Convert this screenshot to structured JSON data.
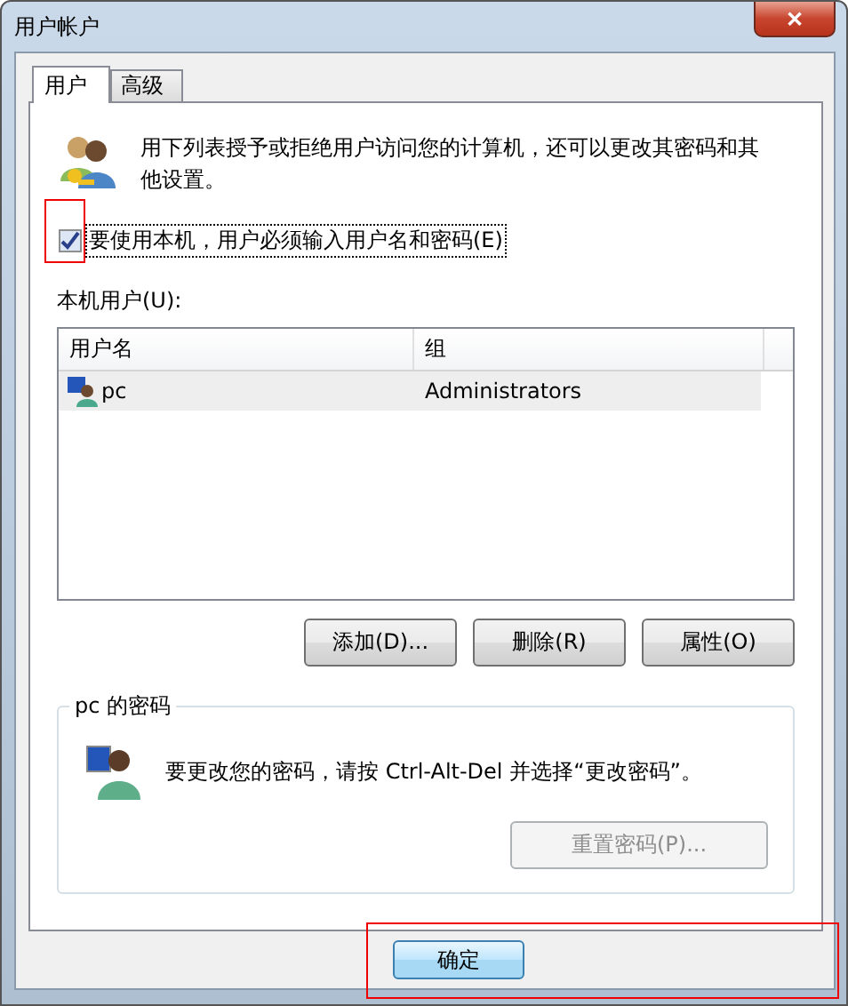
{
  "window": {
    "title": "用户帐户",
    "close": "✕"
  },
  "tabs": [
    {
      "label": "用户",
      "selected": true
    },
    {
      "label": "高级",
      "selected": false
    }
  ],
  "intro": "用下列表授予或拒绝用户访问您的计算机，还可以更改其密码和其他设置。",
  "require_login": {
    "label": "要使用本机，用户必须输入用户名和密码(E)",
    "checked": true,
    "highlighted": true
  },
  "users_label": "本机用户(U):",
  "table": {
    "columns": [
      "用户名",
      "组"
    ],
    "rows": [
      {
        "cells": [
          "pc",
          "Administrators"
        ],
        "selected": true
      }
    ]
  },
  "user_buttons": [
    "添加(D)...",
    "删除(R)",
    "属性(O)"
  ],
  "password_group": {
    "title": "pc 的密码",
    "message": "要更改您的密码，请按 Ctrl-Alt-Del 并选择“更改密码”。",
    "reset_button": {
      "label": "重置密码(P)...",
      "disabled": true
    }
  },
  "ok_button": {
    "label": "确定",
    "highlighted": true
  }
}
